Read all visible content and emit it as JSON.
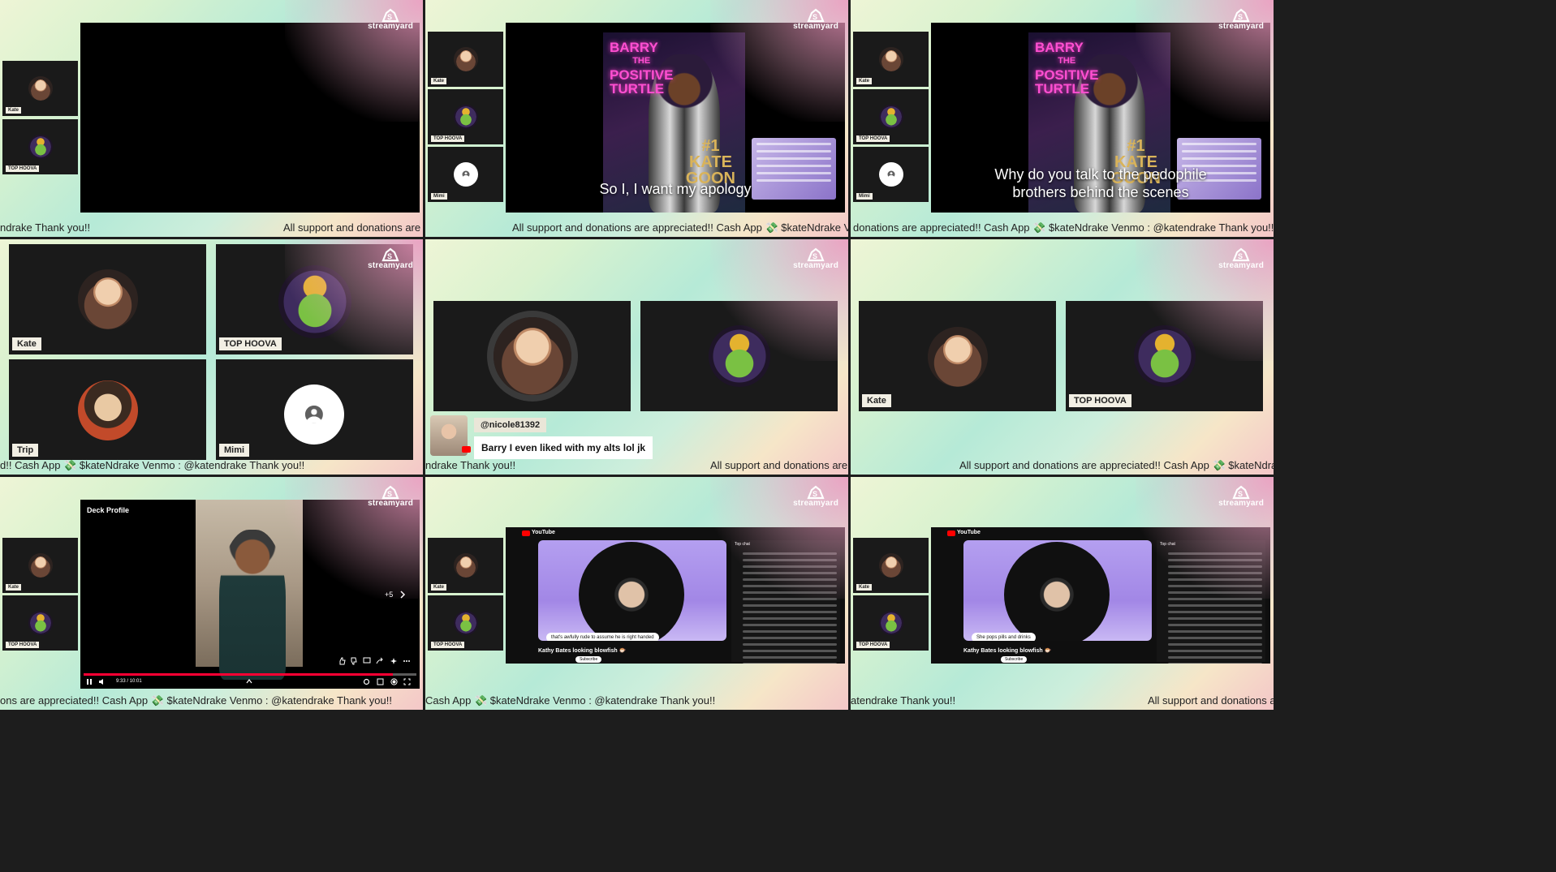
{
  "brand": {
    "logo_text": "streamyard",
    "accent": "#ffffff",
    "gradient": [
      "#eef5d6",
      "#b6ead7",
      "#f4c7c8"
    ]
  },
  "participants": {
    "kate": "Kate",
    "top_hoova": "TOP HOOVA",
    "trip": "Trip",
    "mimi": "Mimi"
  },
  "ticker_full": "All support and donations are appreciated!! Cash App 💸 $kateNdrake Venmo : @katendrake Thank you!!",
  "tickers": {
    "p1": [
      "ndrake Thank you!!",
      "All support and donations are appr"
    ],
    "p2": [
      "All support and donations are appreciated!! Cash App 💸 $kateNdrake Venmo : @kate"
    ],
    "p3": [
      "donations are appreciated!! Cash App 💸 $kateNdrake Venmo : @katendrake Thank you!!"
    ],
    "p4": [
      "d!! Cash App 💸 $kateNdrake Venmo : @katendrake Thank you!!"
    ],
    "p5": [
      "ndrake Thank you!!",
      "All support and donations are appr"
    ],
    "p6": [
      "All support and donations are appreciated!! Cash App 💸 $kateNdrake Venmo :"
    ],
    "p7": [
      "ons are appreciated!! Cash App 💸 $kateNdrake Venmo : @katendrake Thank you!!"
    ],
    "p8": [
      "Cash App 💸 $kateNdrake Venmo : @katendrake Thank you!!"
    ],
    "p9": [
      "atendrake Thank you!!",
      "All support and donations are a"
    ]
  },
  "captions": {
    "p2": "So I, I want my apology",
    "p3_line1": "Why do you talk to the pedophile",
    "p3_line2": "brothers behind the scenes"
  },
  "poster": {
    "title_lines": [
      "BARRY",
      "THE",
      "POSITIVE",
      "TURTLE"
    ],
    "badge": "#1",
    "badge_text": [
      "KATE",
      "GOON"
    ]
  },
  "comment": {
    "user": "@nicole81392",
    "text": "Barry I even liked with my alts lol jk"
  },
  "deck": {
    "title": "Deck Profile",
    "time": "9:33 / 10:01",
    "more": "+5",
    "progress": 0.93
  },
  "youtube": {
    "brand": "YouTube",
    "video_title": "Kathy Bates looking blowfish 🐡",
    "bubble_p8": "that's awfully rude to assume he is right handed",
    "bubble_p9": "She pops pills and drinks",
    "subscribe": "Subscribe",
    "top_chat": "Top chat"
  }
}
